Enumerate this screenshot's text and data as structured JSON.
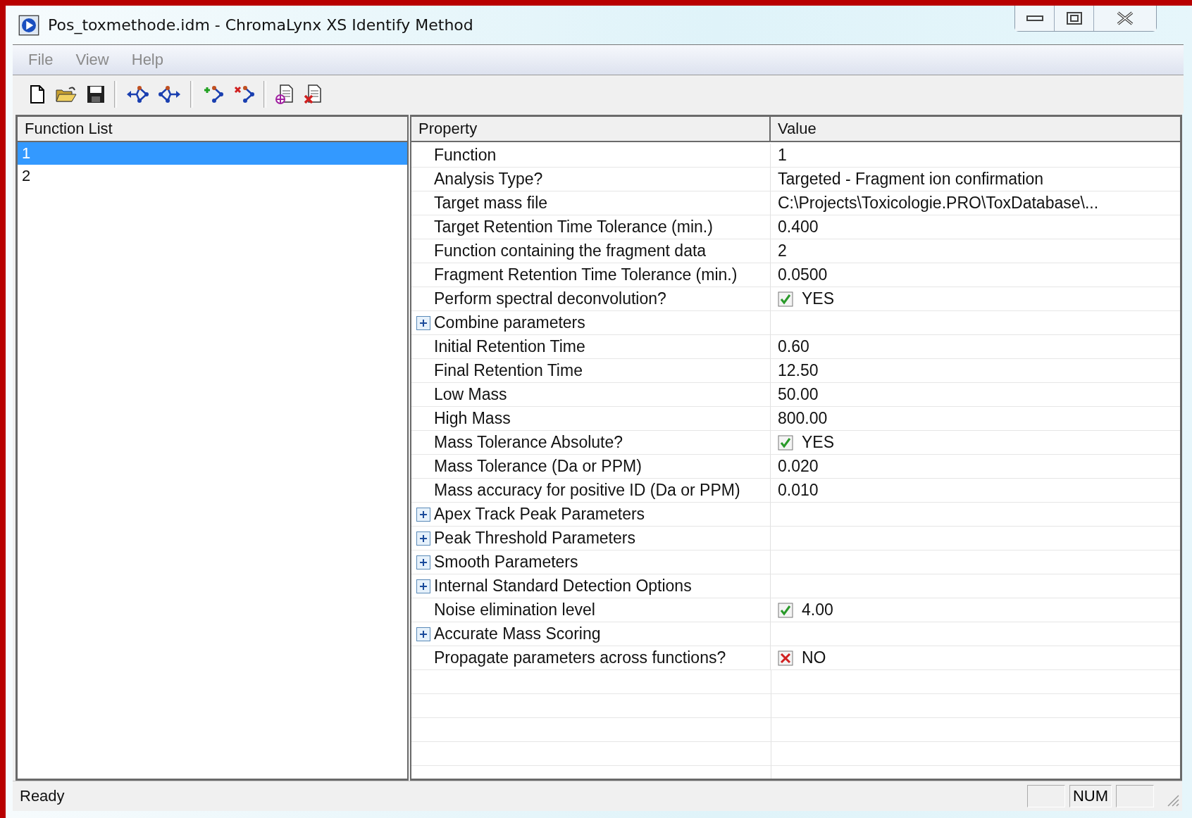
{
  "window": {
    "title": "Pos_toxmethode.idm - ChromaLynx XS Identify Method"
  },
  "menu": [
    {
      "label": "File",
      "disabled": true
    },
    {
      "label": "View",
      "disabled": true
    },
    {
      "label": "Help",
      "disabled": true
    }
  ],
  "toolbar": [
    {
      "kind": "new"
    },
    {
      "kind": "open"
    },
    {
      "kind": "save"
    },
    {
      "kind": "sep"
    },
    {
      "kind": "node-left"
    },
    {
      "kind": "node-right"
    },
    {
      "kind": "sep"
    },
    {
      "kind": "node-add"
    },
    {
      "kind": "node-delete"
    },
    {
      "kind": "sep"
    },
    {
      "kind": "doc-add"
    },
    {
      "kind": "doc-delete"
    }
  ],
  "function_list": {
    "title": "Function List",
    "items": [
      {
        "label": "1",
        "selected": true
      },
      {
        "label": "2",
        "selected": false
      }
    ]
  },
  "properties": {
    "columns": [
      "Property",
      "Value"
    ],
    "rows": [
      {
        "kind": "text",
        "property": "Function",
        "value": "1"
      },
      {
        "kind": "text",
        "property": "Analysis Type?",
        "value": "Targeted - Fragment ion confirmation"
      },
      {
        "kind": "text",
        "property": "Target mass file",
        "value": "C:\\Projects\\Toxicologie.PRO\\ToxDatabase\\..."
      },
      {
        "kind": "text",
        "property": "Target Retention Time Tolerance (min.)",
        "value": "0.400"
      },
      {
        "kind": "text",
        "property": "Function containing the fragment data",
        "value": "2"
      },
      {
        "kind": "text",
        "property": "Fragment Retention Time Tolerance (min.)",
        "value": "0.0500"
      },
      {
        "kind": "check",
        "property": "Perform spectral deconvolution?",
        "checked": true,
        "value": "YES"
      },
      {
        "kind": "group",
        "property": "Combine parameters",
        "expanded": false
      },
      {
        "kind": "text",
        "property": "Initial Retention Time",
        "value": "0.60"
      },
      {
        "kind": "text",
        "property": "Final Retention Time",
        "value": "12.50"
      },
      {
        "kind": "text",
        "property": "Low Mass",
        "value": "50.00"
      },
      {
        "kind": "text",
        "property": "High Mass",
        "value": "800.00"
      },
      {
        "kind": "check",
        "property": "Mass Tolerance Absolute?",
        "checked": true,
        "value": "YES"
      },
      {
        "kind": "text",
        "property": "Mass Tolerance (Da or PPM)",
        "value": "0.020"
      },
      {
        "kind": "text",
        "property": "Mass accuracy for positive ID (Da or PPM)",
        "value": "0.010"
      },
      {
        "kind": "group",
        "property": "Apex Track Peak Parameters",
        "expanded": false
      },
      {
        "kind": "group",
        "property": "Peak Threshold Parameters",
        "expanded": false
      },
      {
        "kind": "group",
        "property": "Smooth Parameters",
        "expanded": false
      },
      {
        "kind": "group",
        "property": "Internal Standard Detection Options",
        "expanded": false
      },
      {
        "kind": "check",
        "property": "Noise elimination level",
        "checked": true,
        "value": "4.00"
      },
      {
        "kind": "group",
        "property": "Accurate Mass Scoring",
        "expanded": false
      },
      {
        "kind": "check",
        "property": "Propagate parameters across functions?",
        "checked": false,
        "value": "NO"
      }
    ]
  },
  "status_bar": {
    "text": "Ready",
    "num_indicator": "NUM"
  }
}
